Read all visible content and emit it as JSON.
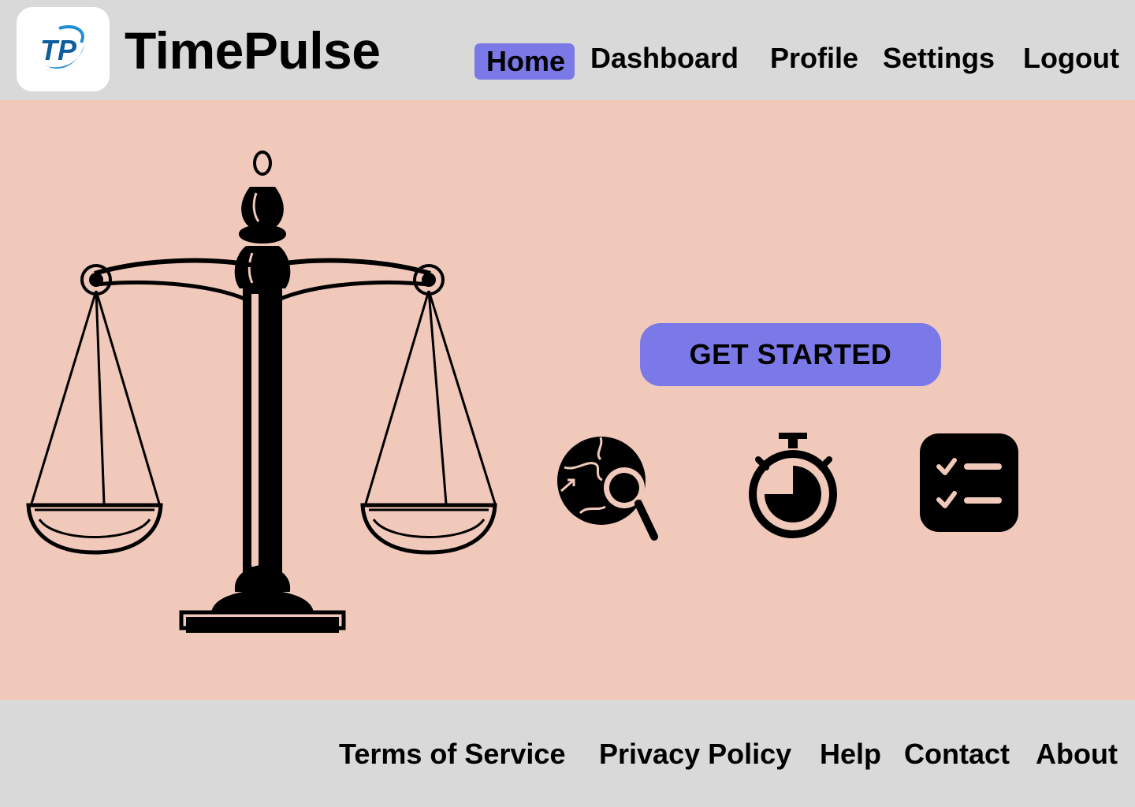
{
  "header": {
    "logo_text": "TP",
    "app_title": "TimePulse",
    "nav": [
      {
        "label": "Home",
        "active": true
      },
      {
        "label": "Dashboard",
        "active": false
      },
      {
        "label": "Profile",
        "active": false
      },
      {
        "label": "Settings",
        "active": false
      },
      {
        "label": "Logout",
        "active": false
      }
    ]
  },
  "hero": {
    "illustration": "balance-scale-icon",
    "cta_label": "GET STARTED",
    "features": [
      {
        "icon": "global-search-icon"
      },
      {
        "icon": "stopwatch-icon"
      },
      {
        "icon": "checklist-icon"
      }
    ]
  },
  "footer": {
    "links": [
      "Terms of Service",
      "Privacy Policy",
      "Help",
      "Contact",
      "About"
    ]
  },
  "colors": {
    "chrome_background": "#d9d9d9",
    "hero_background": "#f1c9bb",
    "accent": "#7b79e8",
    "logo_blue": "#1e8fd6",
    "text": "#000000"
  }
}
